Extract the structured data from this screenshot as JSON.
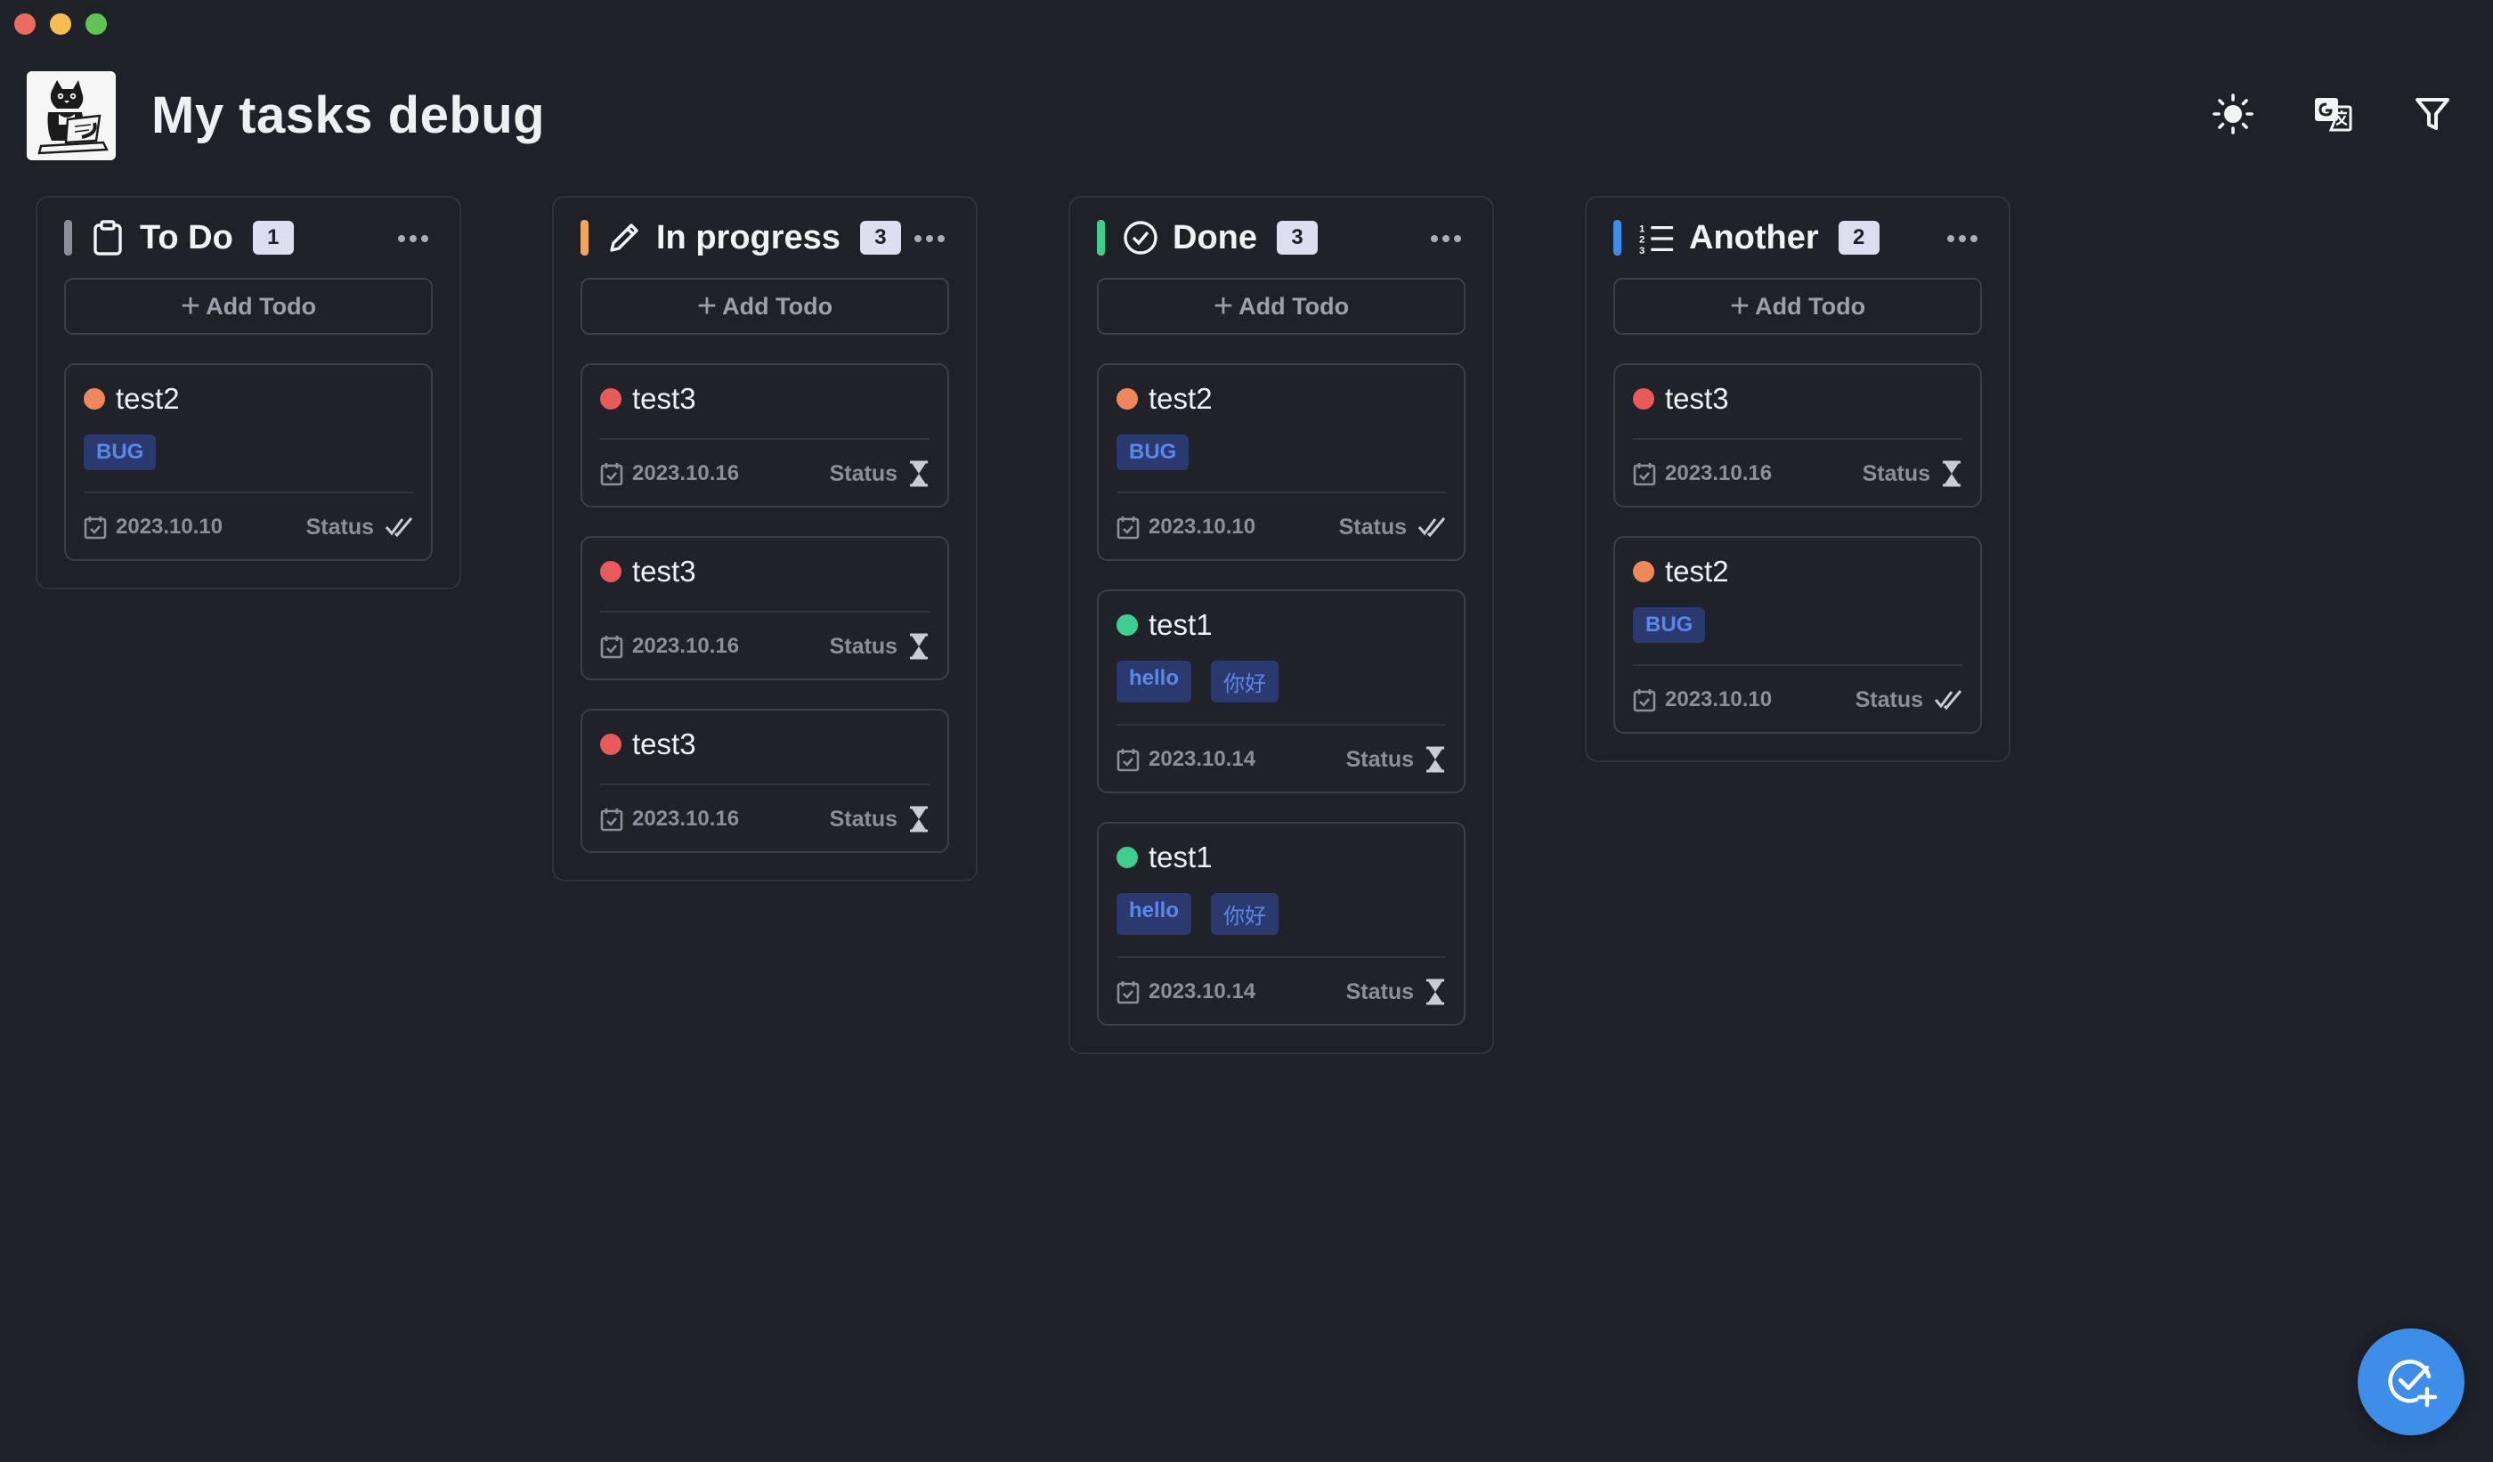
{
  "header": {
    "title": "My tasks debug",
    "logo_icon": "cat-laptop-logo",
    "actions": [
      {
        "name": "theme-toggle-button",
        "icon": "sun-icon"
      },
      {
        "name": "translate-button",
        "icon": "translate-icon"
      },
      {
        "name": "filter-button",
        "icon": "filter-icon"
      }
    ]
  },
  "colors": {
    "background": "#1e2127",
    "todo_bar": "#8a8f99",
    "progress_bar": "#f2a65a",
    "done_bar": "#3ecf8e",
    "another_bar": "#3d8ee8",
    "dot_orange": "#f0875a",
    "dot_red": "#e85a5a",
    "dot_green": "#3ecf8e",
    "fab": "#3d8ee8"
  },
  "add_label": "Add Todo",
  "status_label": "Status",
  "columns": [
    {
      "title": "To Do",
      "count": "1",
      "icon": "clipboard-icon",
      "cards": [
        {
          "title": "test2",
          "tags": [
            "BUG"
          ],
          "date": "2023.10.10",
          "status_icon": "double-check-icon"
        }
      ]
    },
    {
      "title": "In progress",
      "count": "3",
      "icon": "pencil-icon",
      "cards": [
        {
          "title": "test3",
          "tags": [],
          "date": "2023.10.16",
          "status_icon": "hourglass-icon"
        },
        {
          "title": "test3",
          "tags": [],
          "date": "2023.10.16",
          "status_icon": "hourglass-icon"
        },
        {
          "title": "test3",
          "tags": [],
          "date": "2023.10.16",
          "status_icon": "hourglass-icon"
        }
      ]
    },
    {
      "title": "Done",
      "count": "3",
      "icon": "check-circle-icon",
      "cards": [
        {
          "title": "test2",
          "tags": [
            "BUG"
          ],
          "date": "2023.10.10",
          "status_icon": "double-check-icon"
        },
        {
          "title": "test1",
          "tags": [
            "hello",
            "你好"
          ],
          "date": "2023.10.14",
          "status_icon": "hourglass-icon"
        },
        {
          "title": "test1",
          "tags": [
            "hello",
            "你好"
          ],
          "date": "2023.10.14",
          "status_icon": "hourglass-icon"
        }
      ]
    },
    {
      "title": "Another",
      "count": "2",
      "icon": "numbered-list-icon",
      "cards": [
        {
          "title": "test3",
          "tags": [],
          "date": "2023.10.16",
          "status_icon": "hourglass-icon"
        },
        {
          "title": "test2",
          "tags": [
            "BUG"
          ],
          "date": "2023.10.10",
          "status_icon": "double-check-icon"
        }
      ]
    }
  ],
  "fab_icon": "add-task-icon"
}
